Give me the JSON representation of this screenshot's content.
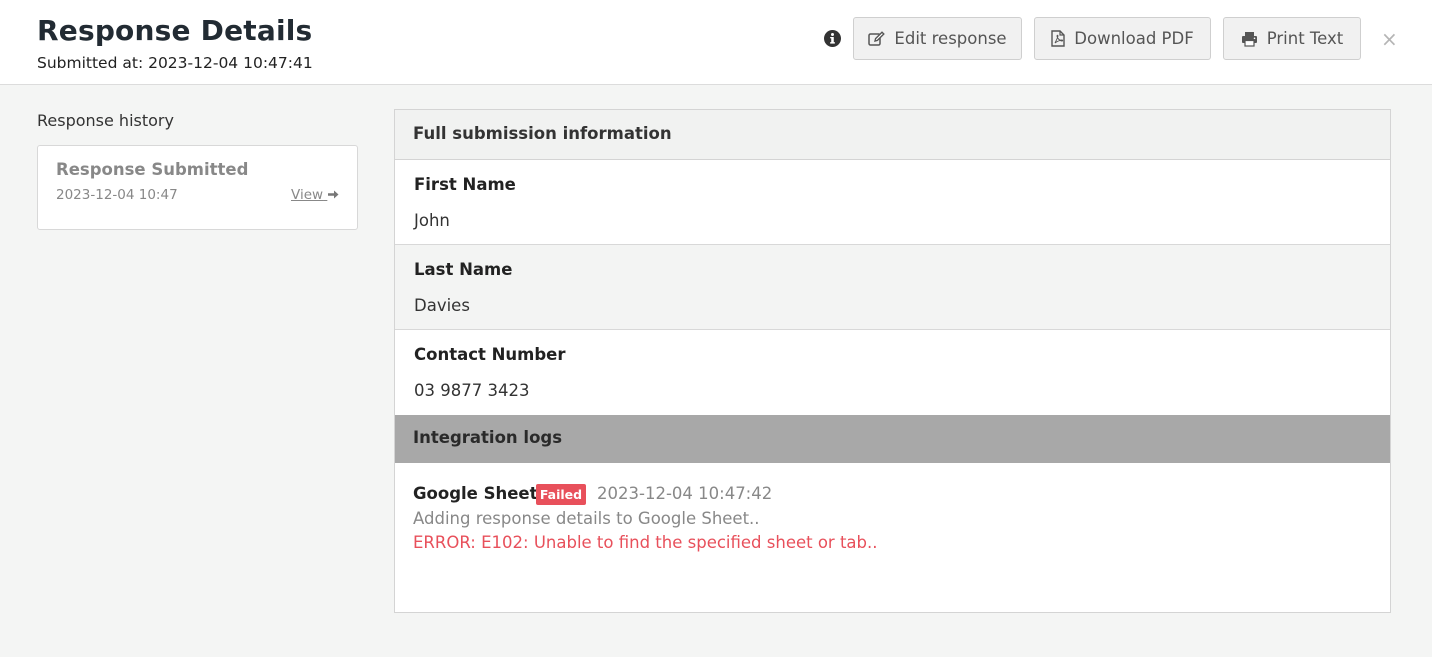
{
  "header": {
    "title": "Response Details",
    "submitted": "Submitted at: 2023-12-04 10:47:41",
    "buttons": {
      "edit": "Edit response",
      "pdf": "Download PDF",
      "print": "Print Text"
    },
    "close": "×"
  },
  "history": {
    "label": "Response history",
    "items": [
      {
        "title": "Response Submitted",
        "date": "2023-12-04 10:47",
        "view": "View"
      }
    ]
  },
  "submission": {
    "heading": "Full submission information",
    "fields": [
      {
        "label": "First Name",
        "value": "John"
      },
      {
        "label": "Last Name",
        "value": "Davies"
      },
      {
        "label": "Contact Number",
        "value": "03 9877 3423"
      }
    ]
  },
  "logs": {
    "heading": "Integration logs",
    "entries": [
      {
        "service": "Google Sheets",
        "status": "Failed",
        "time": "2023-12-04 10:47:42",
        "message": "Adding response details to Google Sheet..",
        "error": "ERROR: E102: Unable to find the specified sheet or tab.."
      }
    ]
  },
  "colors": {
    "accent_error": "#e8505b",
    "alt_row": "#f3f4f3",
    "logs_header": "#a8a8a8"
  }
}
